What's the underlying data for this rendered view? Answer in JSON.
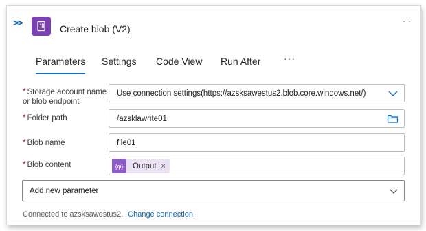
{
  "header": {
    "expand_icon": "chevron-double-right-icon",
    "app_icon": "blob-storage-icon",
    "title": "Create blob (V2)",
    "more_icon": "ellipsis-icon"
  },
  "tabs": [
    {
      "label": "Parameters",
      "active": true
    },
    {
      "label": "Settings",
      "active": false
    },
    {
      "label": "Code View",
      "active": false
    },
    {
      "label": "Run After",
      "active": false
    }
  ],
  "tabs_more": "···",
  "fields": {
    "storage_account": {
      "label_line1": "Storage account name",
      "label_line2": "or blob endpoint",
      "value": "Use connection settings(https://azsksawestus2.blob.core.windows.net/)",
      "required_mark": "*"
    },
    "folder_path": {
      "label": "Folder path",
      "value": "/azsklawrite01",
      "required_mark": "*"
    },
    "blob_name": {
      "label": "Blob name",
      "value": "file01",
      "required_mark": "*"
    },
    "blob_content": {
      "label": "Blob content",
      "token_label": "Output",
      "token_close": "×",
      "required_mark": "*"
    }
  },
  "add_parameter": {
    "label": "Add new parameter"
  },
  "footer": {
    "connected_text": "Connected to azsksawestus2.",
    "change_link": "Change connection."
  },
  "colors": {
    "accent": "#0f6cbd",
    "required": "#c50f1f",
    "app_icon_bg": "#7a3fb0",
    "token_bg": "#ebe3f4",
    "token_icon_bg": "#8d5bc6"
  }
}
